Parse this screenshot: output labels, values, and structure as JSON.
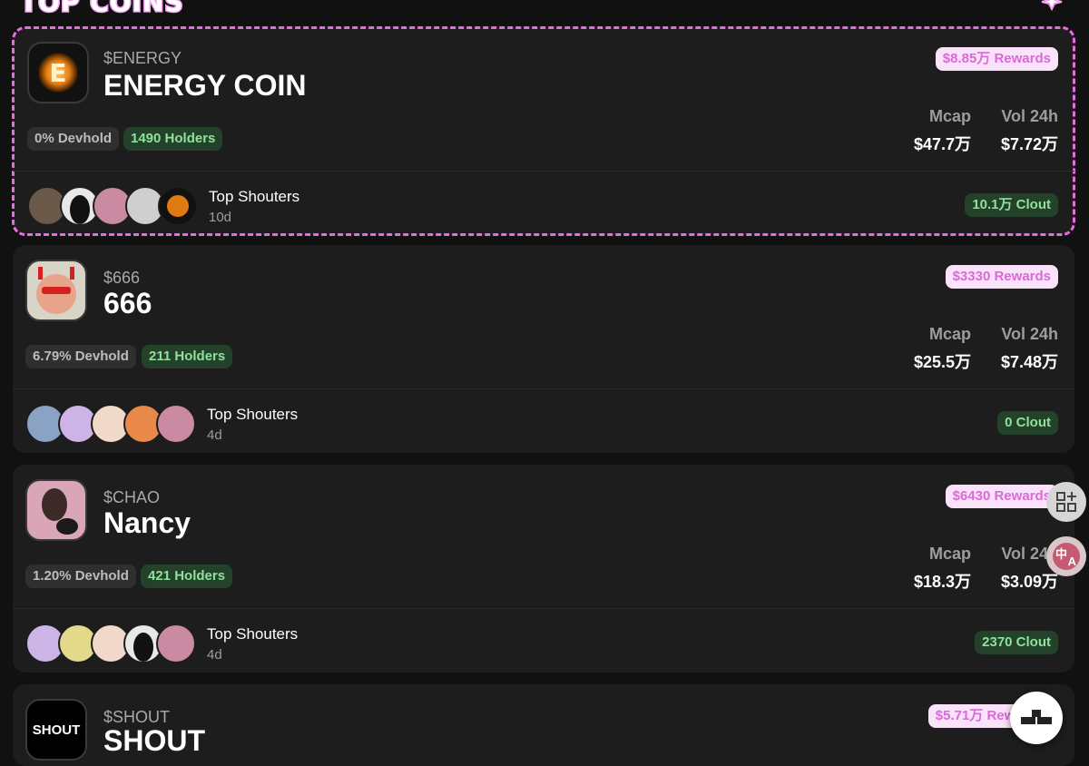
{
  "page": {
    "heading": "TOP COINS"
  },
  "colors": {
    "background": "#111111",
    "card": "#1d1d1d",
    "accent": "#e86be0",
    "rewards_bg": "#fbe2fb",
    "rewards_text": "#d96ad6",
    "green_bg": "#24422a",
    "green_text": "#8fe19b"
  },
  "labels": {
    "mcap": "Mcap",
    "vol": "Vol 24h",
    "top_shouters": "Top Shouters"
  },
  "coins": [
    {
      "ticker": "$ENERGY",
      "name": "ENERGY COIN",
      "rewards": "$8.85万 Rewards",
      "devhold": "0% Devhold",
      "holders": "1490 Holders",
      "mcap": "$47.7万",
      "vol": "$7.72万",
      "shouters_age": "10d",
      "clout": "10.1万 Clout",
      "icon": "energy-coin-logo"
    },
    {
      "ticker": "$666",
      "name": "666",
      "rewards": "$3330 Rewards",
      "devhold": "6.79% Devhold",
      "holders": "211 Holders",
      "mcap": "$25.5万",
      "vol": "$7.48万",
      "shouters_age": "4d",
      "clout": "0 Clout",
      "icon": "cartoon-face-avatar"
    },
    {
      "ticker": "$CHAO",
      "name": "Nancy",
      "rewards": "$6430 Rewards",
      "devhold": "1.20% Devhold",
      "holders": "421 Holders",
      "mcap": "$18.3万",
      "vol": "$3.09万",
      "shouters_age": "4d",
      "clout": "2370 Clout",
      "icon": "portrait-avatar"
    },
    {
      "ticker": "$SHOUT",
      "name": "SHOUT",
      "rewards": "$5.71万 Rewards",
      "logo_text": "SHOUT",
      "icon": "shout-logo"
    }
  ],
  "side_controls": {
    "translate_glyph": "中",
    "translate_glyph_2": "A"
  }
}
